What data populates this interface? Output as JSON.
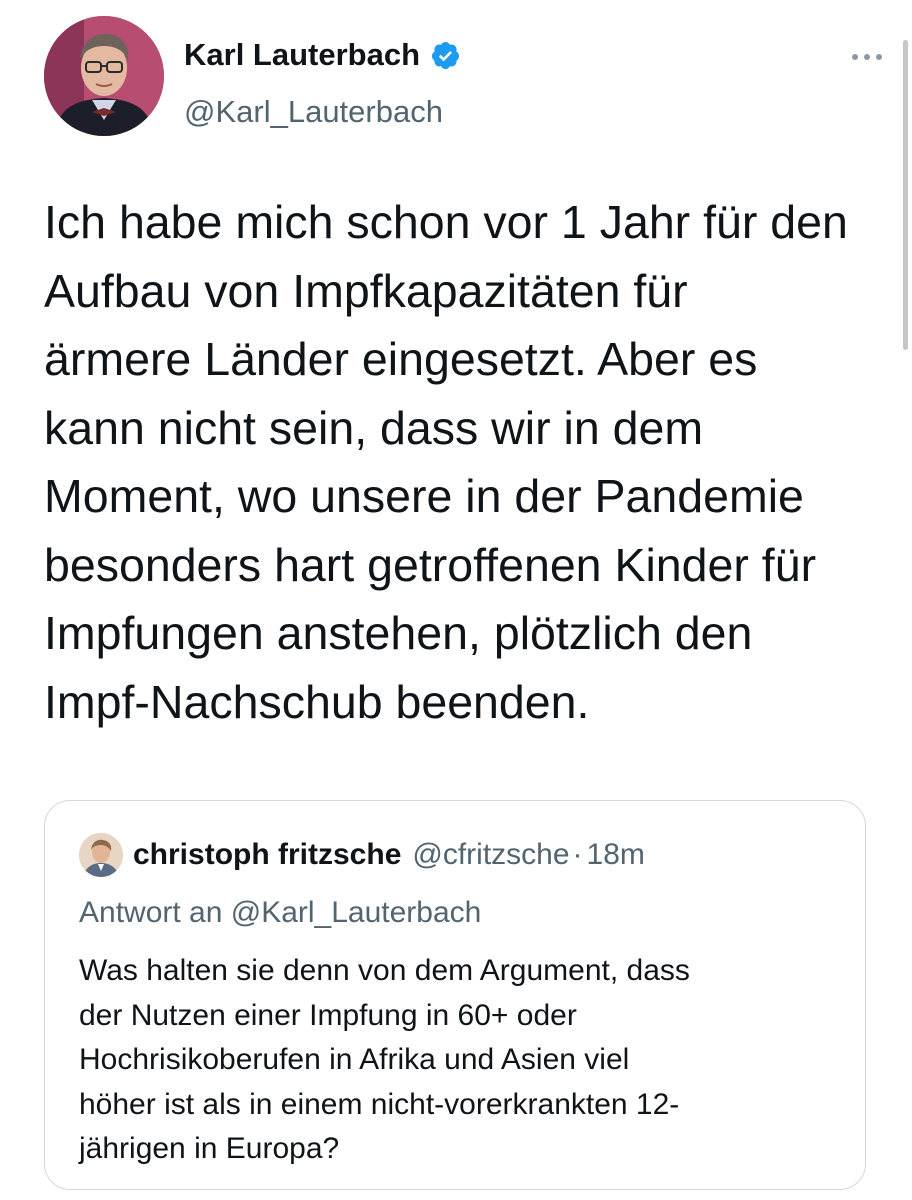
{
  "tweet": {
    "author": {
      "display_name": "Karl Lauterbach",
      "handle": "@Karl_Lauterbach",
      "verified_icon": "verified-badge-icon",
      "avatar_icon": "avatar-photo"
    },
    "more_icon": "more-options-icon",
    "text": "Ich habe mich schon vor 1 Jahr für den\nAufbau von Impfkapazitäten für\närmere Länder eingesetzt. Aber es\nkann nicht sein, dass wir in dem\nMoment, wo unsere in der Pandemie\nbesonders hart getroffenen Kinder für\nImpfungen anstehen, plötzlich den\nImpf-Nachschub beenden."
  },
  "quoted_tweet": {
    "author": {
      "display_name": "christoph fritzsche",
      "handle": "@cfritzsche",
      "separator": "·",
      "time": "18m"
    },
    "reply_to": "Antwort an @Karl_Lauterbach",
    "text": "Was halten sie denn von dem Argument, dass\nder Nutzen einer Impfung in 60+ oder\nHochrisikoberufen in Afrika und Asien viel\nhöher ist als in einem nicht-vorerkrankten 12-\njährigen in Europa?"
  },
  "colors": {
    "text_primary": "#0f1419",
    "text_secondary": "#536471",
    "verified_blue": "#1d9bf0",
    "border": "#cfd9de"
  }
}
